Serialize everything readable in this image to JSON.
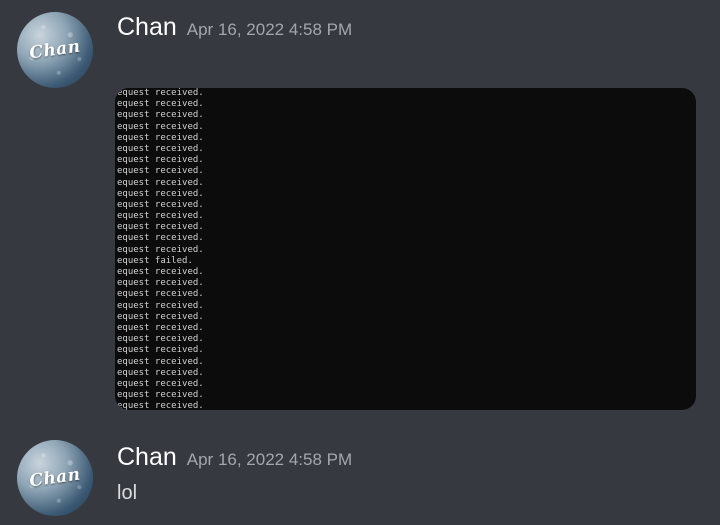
{
  "colors": {
    "background": "#36393f",
    "username": "#ffffff",
    "timestamp": "#a3a6aa",
    "message_text": "#dcddde",
    "terminal_background": "#0c0c0c",
    "terminal_text": "#d2d2d2"
  },
  "messages": [
    {
      "avatar": {
        "label": "Chan"
      },
      "username": "Chan",
      "timestamp": "Apr 16, 2022 4:58 PM",
      "attachment": {
        "type": "image",
        "lines": [
          "equest received.",
          "equest received.",
          "equest received.",
          "equest received.",
          "equest received.",
          "equest received.",
          "equest received.",
          "equest received.",
          "equest received.",
          "equest received.",
          "equest received.",
          "equest received.",
          "equest received.",
          "equest received.",
          "equest received.",
          "equest failed.",
          "equest received.",
          "equest received.",
          "equest received.",
          "equest received.",
          "equest received.",
          "equest received.",
          "equest received.",
          "equest received.",
          "equest received.",
          "equest received.",
          "equest received.",
          "equest received.",
          "equest received."
        ]
      }
    },
    {
      "avatar": {
        "label": "Chan"
      },
      "username": "Chan",
      "timestamp": "Apr 16, 2022 4:58 PM",
      "text": "lol"
    }
  ]
}
